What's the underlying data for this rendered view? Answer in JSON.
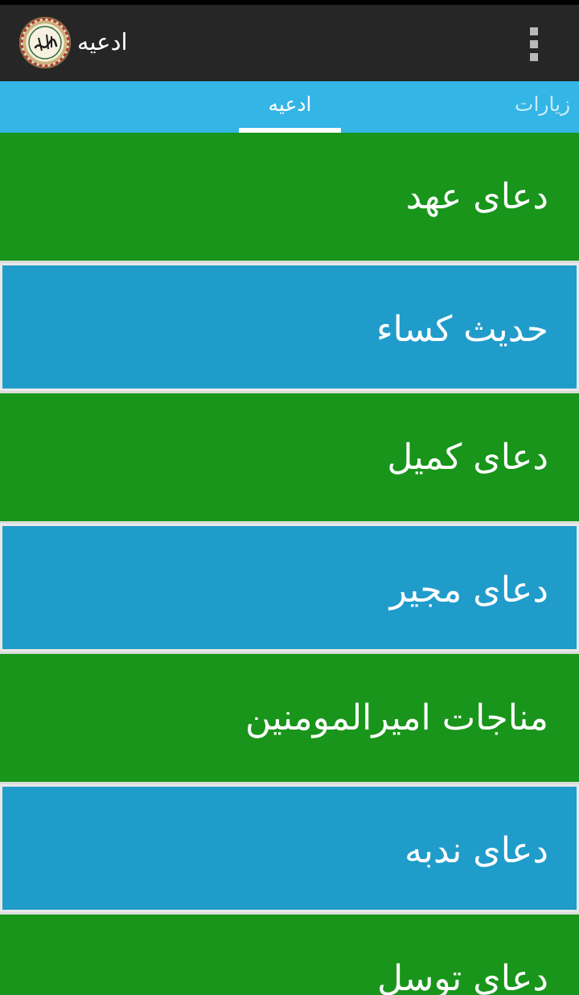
{
  "actionbar": {
    "title": "ادعیه",
    "app_icon": "bismillah-calligraphy-icon",
    "overflow_icon": "overflow-menu-icon"
  },
  "tabs": [
    {
      "label": "ادعیه",
      "active": true
    },
    {
      "label": "زیارات",
      "active": false
    }
  ],
  "colors": {
    "actionbar_bg": "#262626",
    "tabbar_bg": "#33b5e5",
    "row_green": "#18951a",
    "row_blue": "#209ccb",
    "text": "#ffffff"
  },
  "list": {
    "items": [
      {
        "label": "دعای عهد",
        "color": "green"
      },
      {
        "label": "حدیث کساء",
        "color": "blue"
      },
      {
        "label": "دعای کمیل",
        "color": "green"
      },
      {
        "label": "دعای مجیر",
        "color": "blue"
      },
      {
        "label": "مناجات امیرالمومنین",
        "color": "green"
      },
      {
        "label": "دعای ندبه",
        "color": "blue"
      },
      {
        "label": "دعای توسل",
        "color": "green"
      }
    ]
  }
}
